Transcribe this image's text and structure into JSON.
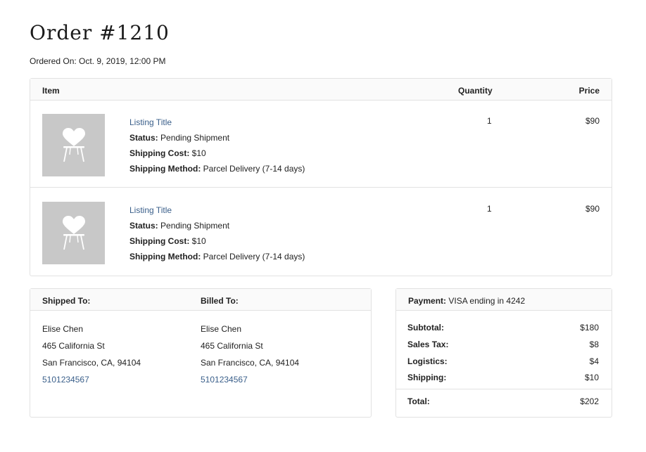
{
  "order": {
    "title": "Order #1210",
    "ordered_on_label": "Ordered On:",
    "ordered_on_value": "Oct. 9, 2019, 12:00 PM"
  },
  "items_table": {
    "headers": {
      "item": "Item",
      "quantity": "Quantity",
      "price": "Price"
    },
    "rows": [
      {
        "title": "Listing Title",
        "status_label": "Status:",
        "status_value": "Pending Shipment",
        "shipping_cost_label": "Shipping Cost:",
        "shipping_cost_value": "$10",
        "shipping_method_label": "Shipping Method:",
        "shipping_method_value": "Parcel Delivery (7-14 days)",
        "quantity": "1",
        "price": "$90",
        "thumbnail_icon": "chair-icon"
      },
      {
        "title": "Listing Title",
        "status_label": "Status:",
        "status_value": "Pending Shipment",
        "shipping_cost_label": "Shipping Cost:",
        "shipping_cost_value": "$10",
        "shipping_method_label": "Shipping Method:",
        "shipping_method_value": "Parcel Delivery (7-14 days)",
        "quantity": "1",
        "price": "$90",
        "thumbnail_icon": "chair-icon"
      }
    ]
  },
  "shipping": {
    "header": "Shipped To:",
    "name": "Elise Chen",
    "street": "465 California St",
    "city": "San Francisco, CA, 94104",
    "phone": "5101234567"
  },
  "billing": {
    "header": "Billed To:",
    "name": "Elise Chen",
    "street": "465 California St",
    "city": "San Francisco, CA, 94104",
    "phone": "5101234567"
  },
  "payment": {
    "header_label": "Payment:",
    "header_value": "VISA ending in 4242",
    "rows": [
      {
        "label": "Subtotal:",
        "value": "$180"
      },
      {
        "label": "Sales Tax:",
        "value": "$8"
      },
      {
        "label": "Logistics:",
        "value": "$4"
      },
      {
        "label": "Shipping:",
        "value": "$10"
      }
    ],
    "total_label": "Total:",
    "total_value": "$202"
  },
  "colors": {
    "link": "#3a5f8a",
    "thumbnail_bg": "#c8c8c8",
    "border": "#e2e2e2",
    "header_bg": "#fafafa"
  }
}
